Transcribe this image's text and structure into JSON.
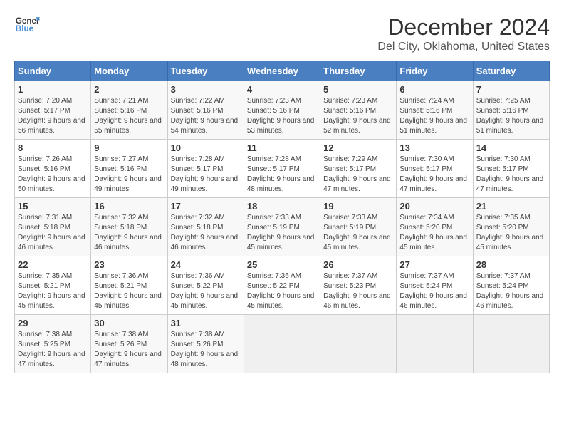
{
  "logo": {
    "line1": "General",
    "line2": "Blue"
  },
  "title": "December 2024",
  "subtitle": "Del City, Oklahoma, United States",
  "days_of_week": [
    "Sunday",
    "Monday",
    "Tuesday",
    "Wednesday",
    "Thursday",
    "Friday",
    "Saturday"
  ],
  "weeks": [
    [
      {
        "day": "1",
        "sunrise": "7:20 AM",
        "sunset": "5:17 PM",
        "daylight": "9 hours and 56 minutes."
      },
      {
        "day": "2",
        "sunrise": "7:21 AM",
        "sunset": "5:16 PM",
        "daylight": "9 hours and 55 minutes."
      },
      {
        "day": "3",
        "sunrise": "7:22 AM",
        "sunset": "5:16 PM",
        "daylight": "9 hours and 54 minutes."
      },
      {
        "day": "4",
        "sunrise": "7:23 AM",
        "sunset": "5:16 PM",
        "daylight": "9 hours and 53 minutes."
      },
      {
        "day": "5",
        "sunrise": "7:23 AM",
        "sunset": "5:16 PM",
        "daylight": "9 hours and 52 minutes."
      },
      {
        "day": "6",
        "sunrise": "7:24 AM",
        "sunset": "5:16 PM",
        "daylight": "9 hours and 51 minutes."
      },
      {
        "day": "7",
        "sunrise": "7:25 AM",
        "sunset": "5:16 PM",
        "daylight": "9 hours and 51 minutes."
      }
    ],
    [
      {
        "day": "8",
        "sunrise": "7:26 AM",
        "sunset": "5:16 PM",
        "daylight": "9 hours and 50 minutes."
      },
      {
        "day": "9",
        "sunrise": "7:27 AM",
        "sunset": "5:16 PM",
        "daylight": "9 hours and 49 minutes."
      },
      {
        "day": "10",
        "sunrise": "7:28 AM",
        "sunset": "5:17 PM",
        "daylight": "9 hours and 49 minutes."
      },
      {
        "day": "11",
        "sunrise": "7:28 AM",
        "sunset": "5:17 PM",
        "daylight": "9 hours and 48 minutes."
      },
      {
        "day": "12",
        "sunrise": "7:29 AM",
        "sunset": "5:17 PM",
        "daylight": "9 hours and 47 minutes."
      },
      {
        "day": "13",
        "sunrise": "7:30 AM",
        "sunset": "5:17 PM",
        "daylight": "9 hours and 47 minutes."
      },
      {
        "day": "14",
        "sunrise": "7:30 AM",
        "sunset": "5:17 PM",
        "daylight": "9 hours and 47 minutes."
      }
    ],
    [
      {
        "day": "15",
        "sunrise": "7:31 AM",
        "sunset": "5:18 PM",
        "daylight": "9 hours and 46 minutes."
      },
      {
        "day": "16",
        "sunrise": "7:32 AM",
        "sunset": "5:18 PM",
        "daylight": "9 hours and 46 minutes."
      },
      {
        "day": "17",
        "sunrise": "7:32 AM",
        "sunset": "5:18 PM",
        "daylight": "9 hours and 46 minutes."
      },
      {
        "day": "18",
        "sunrise": "7:33 AM",
        "sunset": "5:19 PM",
        "daylight": "9 hours and 45 minutes."
      },
      {
        "day": "19",
        "sunrise": "7:33 AM",
        "sunset": "5:19 PM",
        "daylight": "9 hours and 45 minutes."
      },
      {
        "day": "20",
        "sunrise": "7:34 AM",
        "sunset": "5:20 PM",
        "daylight": "9 hours and 45 minutes."
      },
      {
        "day": "21",
        "sunrise": "7:35 AM",
        "sunset": "5:20 PM",
        "daylight": "9 hours and 45 minutes."
      }
    ],
    [
      {
        "day": "22",
        "sunrise": "7:35 AM",
        "sunset": "5:21 PM",
        "daylight": "9 hours and 45 minutes."
      },
      {
        "day": "23",
        "sunrise": "7:36 AM",
        "sunset": "5:21 PM",
        "daylight": "9 hours and 45 minutes."
      },
      {
        "day": "24",
        "sunrise": "7:36 AM",
        "sunset": "5:22 PM",
        "daylight": "9 hours and 45 minutes."
      },
      {
        "day": "25",
        "sunrise": "7:36 AM",
        "sunset": "5:22 PM",
        "daylight": "9 hours and 45 minutes."
      },
      {
        "day": "26",
        "sunrise": "7:37 AM",
        "sunset": "5:23 PM",
        "daylight": "9 hours and 46 minutes."
      },
      {
        "day": "27",
        "sunrise": "7:37 AM",
        "sunset": "5:24 PM",
        "daylight": "9 hours and 46 minutes."
      },
      {
        "day": "28",
        "sunrise": "7:37 AM",
        "sunset": "5:24 PM",
        "daylight": "9 hours and 46 minutes."
      }
    ],
    [
      {
        "day": "29",
        "sunrise": "7:38 AM",
        "sunset": "5:25 PM",
        "daylight": "9 hours and 47 minutes."
      },
      {
        "day": "30",
        "sunrise": "7:38 AM",
        "sunset": "5:26 PM",
        "daylight": "9 hours and 47 minutes."
      },
      {
        "day": "31",
        "sunrise": "7:38 AM",
        "sunset": "5:26 PM",
        "daylight": "9 hours and 48 minutes."
      },
      null,
      null,
      null,
      null
    ]
  ],
  "sunrise_label": "Sunrise:",
  "sunset_label": "Sunset:",
  "daylight_label": "Daylight:"
}
